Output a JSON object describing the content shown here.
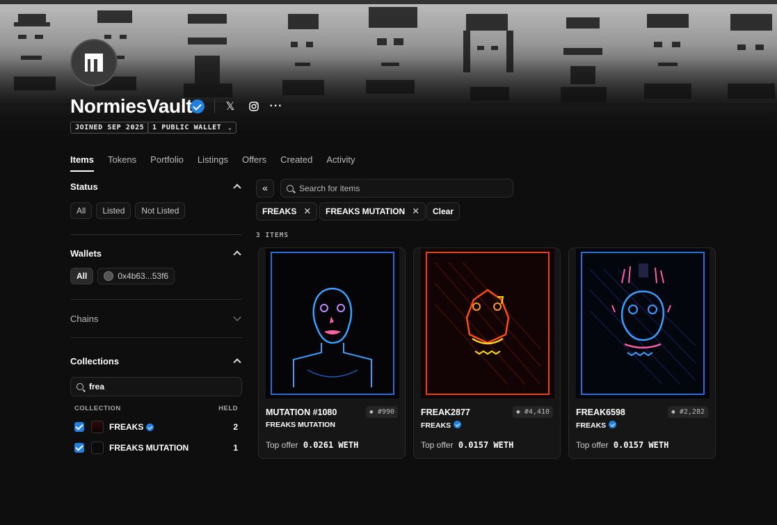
{
  "profile": {
    "name": "NormiesVault",
    "joined": "JOINED SEP 2025",
    "wallets_chip": "1 PUBLIC WALLET",
    "social": [
      "x-icon",
      "instagram-icon",
      "more-icon"
    ]
  },
  "tabs": [
    {
      "label": "Items",
      "active": true
    },
    {
      "label": "Tokens"
    },
    {
      "label": "Portfolio"
    },
    {
      "label": "Listings"
    },
    {
      "label": "Offers"
    },
    {
      "label": "Created"
    },
    {
      "label": "Activity"
    }
  ],
  "sidebar": {
    "status": {
      "title": "Status",
      "options": [
        "All",
        "Listed",
        "Not Listed"
      ]
    },
    "wallets": {
      "title": "Wallets",
      "all": "All",
      "address": "0x4b63...53f6"
    },
    "chains": {
      "title": "Chains"
    },
    "collections": {
      "title": "Collections",
      "search_value": "frea",
      "col_collection": "COLLECTION",
      "col_held": "HELD",
      "rows": [
        {
          "name": "FREAKS",
          "held": "2",
          "verified": true
        },
        {
          "name": "FREAKS MUTATION",
          "held": "1",
          "verified": false
        }
      ]
    }
  },
  "main": {
    "search_placeholder": "Search for items",
    "filters": [
      "FREAKS",
      "FREAKS MUTATION"
    ],
    "clear": "Clear",
    "count": "3 ITEMS",
    "offer_label": "Top offer",
    "items": [
      {
        "name": "MUTATION #1080",
        "rank": "#990",
        "collection": "FREAKS MUTATION",
        "verified": false,
        "offer": "0.0261 WETH"
      },
      {
        "name": "FREAK2877",
        "rank": "#4,410",
        "collection": "FREAKS",
        "verified": true,
        "offer": "0.0157 WETH"
      },
      {
        "name": "FREAK6598",
        "rank": "#2,282",
        "collection": "FREAKS",
        "verified": true,
        "offer": "0.0157 WETH"
      }
    ]
  },
  "colors": {
    "accent": "#2081e2",
    "bg": "#0e0e0e"
  }
}
